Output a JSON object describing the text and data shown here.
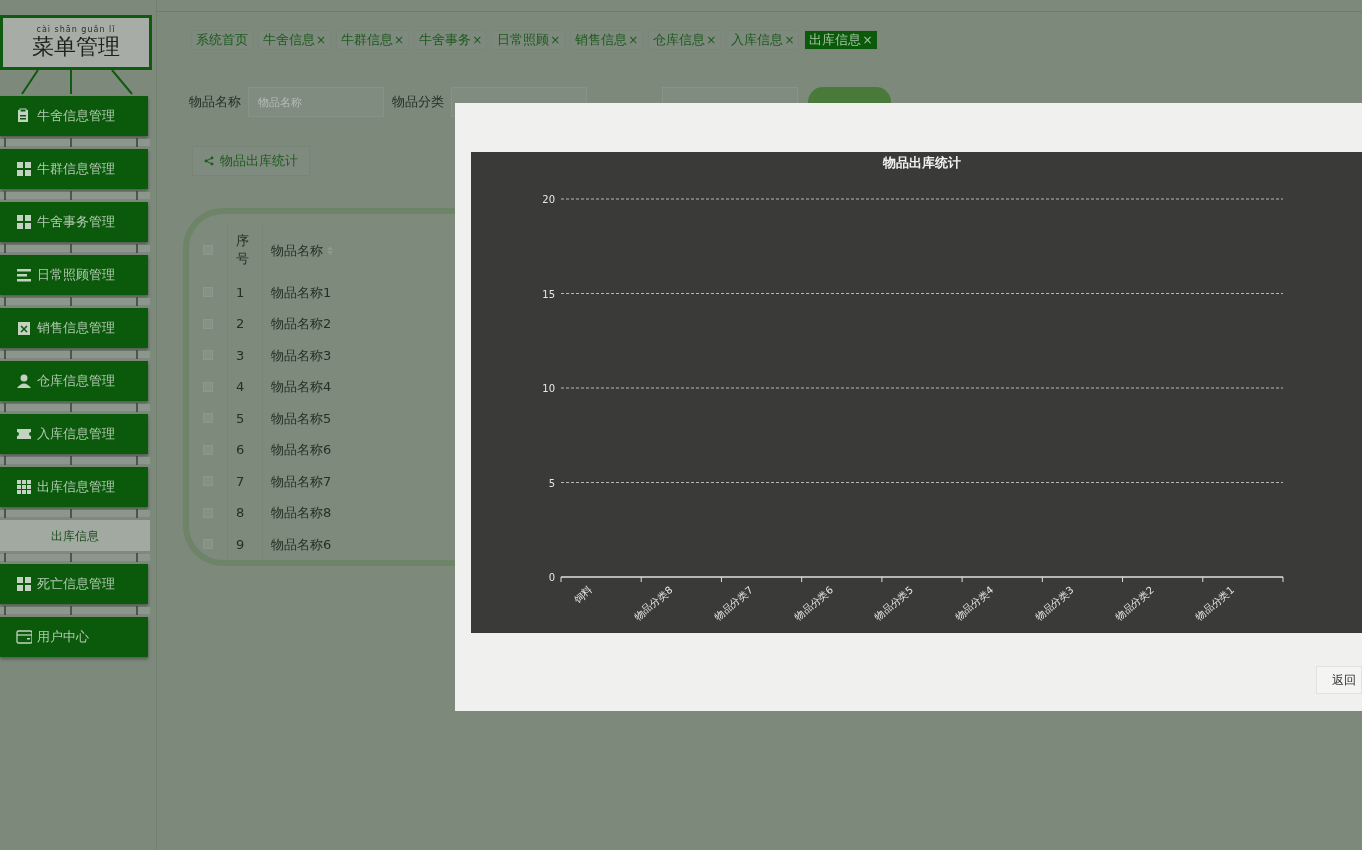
{
  "sidebar": {
    "title": "菜单管理",
    "title_pinyin": "cài shān guǎn lǐ",
    "items": [
      {
        "label": "牛舍信息管理"
      },
      {
        "label": "牛群信息管理"
      },
      {
        "label": "牛舍事务管理"
      },
      {
        "label": "日常照顾管理"
      },
      {
        "label": "销售信息管理"
      },
      {
        "label": "仓库信息管理"
      },
      {
        "label": "入库信息管理"
      },
      {
        "label": "出库信息管理",
        "children": [
          {
            "label": "出库信息"
          }
        ]
      },
      {
        "label": "死亡信息管理"
      },
      {
        "label": "用户中心"
      }
    ]
  },
  "tabs": [
    {
      "label": "系统首页",
      "selected": false
    },
    {
      "label": "牛舍信息",
      "close": "×",
      "selected": false
    },
    {
      "label": "牛群信息",
      "close": "×",
      "selected": false
    },
    {
      "label": "牛舍事务",
      "close": "×",
      "selected": false
    },
    {
      "label": "日常照顾",
      "close": "×",
      "selected": false
    },
    {
      "label": "销售信息",
      "close": "×",
      "selected": false
    },
    {
      "label": "仓库信息",
      "close": "×",
      "selected": false
    },
    {
      "label": "入库信息",
      "close": "×",
      "selected": false
    },
    {
      "label": "出库信息",
      "close": "×",
      "selected": true
    }
  ],
  "search": {
    "fields": [
      {
        "label": "物品名称",
        "placeholder": "物品名称"
      },
      {
        "label": "物品分类"
      }
    ]
  },
  "stats_button": "物品出库统计",
  "table": {
    "select_all_checked": false,
    "columns": [
      "序号",
      "物品名称"
    ],
    "rows": [
      {
        "cells": [
          "1",
          "物品名称1"
        ],
        "checked": false
      },
      {
        "cells": [
          "2",
          "物品名称2"
        ],
        "checked": false
      },
      {
        "cells": [
          "3",
          "物品名称3"
        ],
        "checked": false
      },
      {
        "cells": [
          "4",
          "物品名称4"
        ],
        "checked": false
      },
      {
        "cells": [
          "5",
          "物品名称5"
        ],
        "checked": false
      },
      {
        "cells": [
          "6",
          "物品名称6"
        ],
        "checked": false
      },
      {
        "cells": [
          "7",
          "物品名称7"
        ],
        "checked": false
      },
      {
        "cells": [
          "8",
          "物品名称8"
        ],
        "checked": false
      },
      {
        "cells": [
          "9",
          "物品名称6"
        ],
        "checked": false
      }
    ]
  },
  "modal": {
    "chart_data": {
      "type": "bar",
      "title": "物品出库统计",
      "categories": [
        "饲料",
        "物品分类8",
        "物品分类7",
        "物品分类6",
        "物品分类5",
        "物品分类4",
        "物品分类3",
        "物品分类2",
        "物品分类1"
      ],
      "values": [
        0,
        0,
        0,
        0,
        0,
        0,
        0,
        0,
        0
      ],
      "ylim": [
        0,
        20
      ],
      "yticks": [
        0,
        5,
        10,
        15,
        20
      ],
      "grid": true
    },
    "back_button": "返回"
  }
}
